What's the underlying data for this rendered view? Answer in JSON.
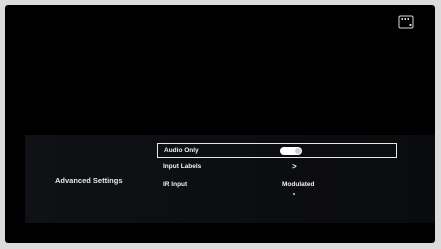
{
  "panel": {
    "title": "Advanced Settings",
    "rows": [
      {
        "label": "Audio Only",
        "type": "toggle",
        "value": "on",
        "selected": true
      },
      {
        "label": "Input Labels",
        "type": "chevron",
        "value": ">",
        "selected": false
      },
      {
        "label": "IR Input",
        "type": "value",
        "value": "Modulated",
        "selected": false
      }
    ]
  },
  "icons": {
    "top_right": "remote-control-icon",
    "row_next": "chevron-right-icon"
  },
  "colors": {
    "background": "#000000",
    "text": "#f2f2f2",
    "panel": "#0f1115"
  }
}
